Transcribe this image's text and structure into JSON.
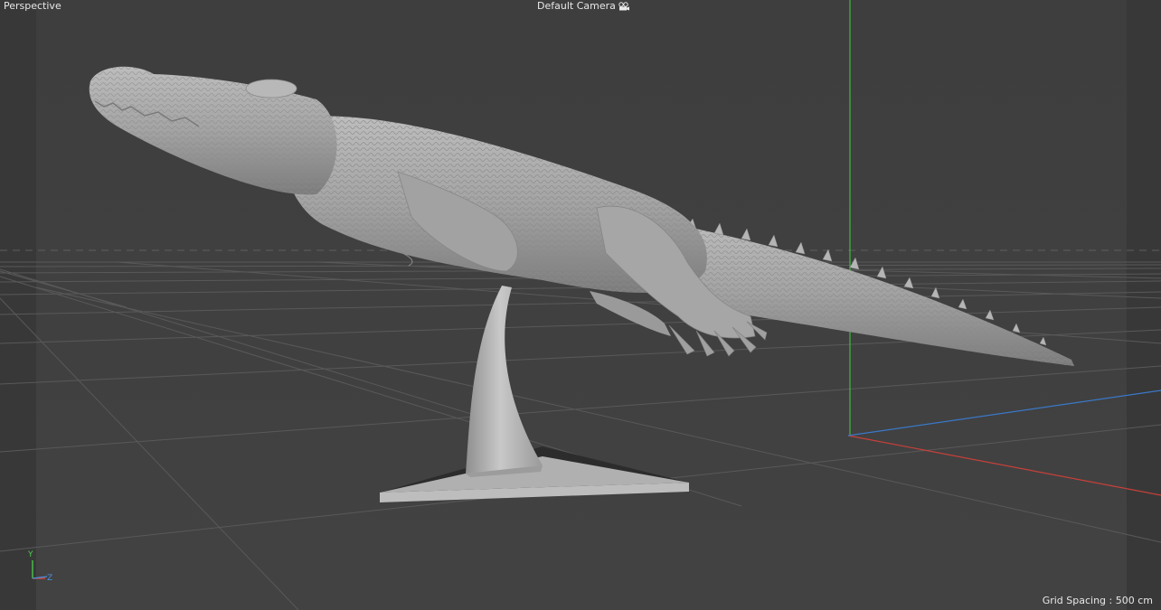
{
  "viewport": {
    "view_name": "Perspective",
    "camera_name": "Default Camera",
    "camera_icon": "camera-icon",
    "grid_spacing": "Grid Spacing : 500 cm"
  },
  "axis_widget": {
    "y_label": "Y",
    "z_label": "Z",
    "x_color": "#e0443a",
    "y_color": "#4ad04a",
    "z_color": "#4a8fe0"
  },
  "scene": {
    "object": "crocodile-sculpture-on-stand",
    "colors": {
      "background": "#3f3f3f",
      "floor": "#444444",
      "grid_line": "#5a5a5a",
      "model": "#a9a9a9",
      "x_axis": "#c8403a",
      "y_axis": "#3fb83f",
      "z_axis": "#3a78c8"
    }
  }
}
